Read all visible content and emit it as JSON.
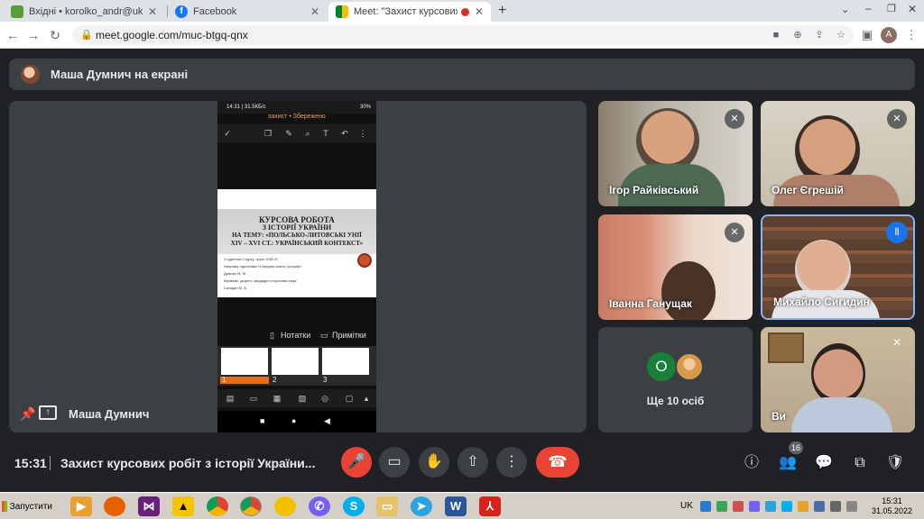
{
  "browser": {
    "tabs": [
      {
        "label": "Вхідні • korolko_andr@ukr.net",
        "icon": "mail-icon",
        "active": false
      },
      {
        "label": "Facebook",
        "icon": "facebook-icon",
        "active": false
      },
      {
        "label": "Meet: \"Захист курсових роб",
        "icon": "meet-icon",
        "active": true
      }
    ],
    "new_tab": "+",
    "url": "meet.google.com/muc-btgq-qnx",
    "profile_initial": "A"
  },
  "meet": {
    "presenter_banner": "Маша Думнич на екрані",
    "presenter_tile_name": "Маша Думнич",
    "participants": [
      {
        "name": "Ігор Райківський",
        "muted": true
      },
      {
        "name": "Олег Єгрешій",
        "muted": true
      },
      {
        "name": "Іванна Ганущак",
        "muted": true
      },
      {
        "name": "Михайло Сигидин",
        "muted": false,
        "speaking": true
      },
      {
        "name": "Ви",
        "muted": true
      }
    ],
    "more": {
      "initial": "О",
      "label": "Ще 10 осіб"
    },
    "clock": "15:31",
    "meeting_title": "Захист курсових робіт з історії України...",
    "people_count": "16"
  },
  "phone_screen": {
    "status_time": "14:31 | 31.5КБ/с",
    "status_battery": "30%",
    "doc_title": "захист • Збережено",
    "slide": {
      "lines": [
        "КУРСОВА РОБОТА",
        "З ІСТОРІЇ УКРАЇНИ",
        "НА ТЕМУ: «ПОЛЬСЬКО-ЛИТОВСЬКІ УНІЇ",
        "XIV – XVI СТ.: УКРАЇНСЬКИЙ КОНТЕКСТ»"
      ],
      "meta": [
        "Студентки II курсу, групи ІОМ-21",
        "Напряму підготовки «Середня освіта (історія)»",
        "Думнич М. М.",
        "Керівник: доцент, кандидат історичних наук",
        "Сигидин М. В."
      ]
    },
    "notes_label": "Нотатки",
    "comments_label": "Примітки",
    "thumbs": [
      "1",
      "2",
      "3"
    ]
  },
  "taskbar": {
    "start_label": "Запустити",
    "lang": "UK",
    "time": "15:31",
    "date": "31.05.2022"
  }
}
